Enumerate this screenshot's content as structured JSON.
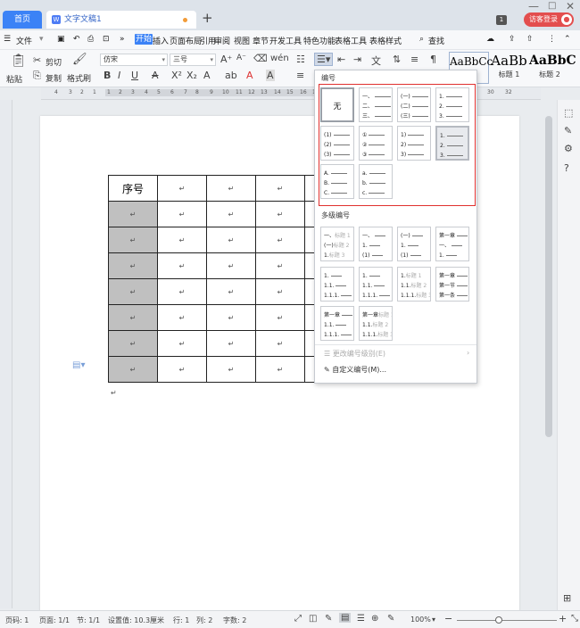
{
  "tabs": {
    "home": "首页",
    "doc": "文字文稿1"
  },
  "title_bar": {
    "page_badge": "1",
    "login_label": "访客登录"
  },
  "menu": {
    "file": "文件",
    "more": "»",
    "items": [
      "开始",
      "插入",
      "页面布局",
      "引用",
      "审阅",
      "视图",
      "章节",
      "开发工具",
      "特色功能",
      "表格工具",
      "表格样式"
    ],
    "active": "开始",
    "search": "查找"
  },
  "toolbar": {
    "paste": "粘贴",
    "cut": "剪切",
    "copy": "复制",
    "format_painter": "格式刷",
    "font_name": "仿宋",
    "font_size": "三号",
    "styles": [
      {
        "preview": "AaBbCc",
        "label": ""
      },
      {
        "preview": "AaBb",
        "label": "标题 1"
      },
      {
        "preview": "AaBbC",
        "label": "标题 2"
      }
    ]
  },
  "ruler": {
    "marks": [
      "4",
      "3",
      "2",
      "1",
      "1",
      "2",
      "3",
      "4",
      "5",
      "6",
      "7",
      "8",
      "9",
      "10",
      "11",
      "12",
      "13",
      "14",
      "15",
      "16",
      "17",
      "18",
      "19",
      "20",
      "28",
      "30",
      "32"
    ]
  },
  "table": {
    "header_first": "序号",
    "cell_mark": "↵",
    "rows": 8,
    "cols": 5
  },
  "numbering_panel": {
    "section_numbering": "编号",
    "none_label": "无",
    "single_level": [
      [
        "一、",
        "二、",
        "三、"
      ],
      [
        "(一)",
        "(二)",
        "(三)"
      ],
      [
        "1.",
        "2.",
        "3."
      ],
      [
        "(1)",
        "(2)",
        "(3)"
      ],
      [
        "①",
        "②",
        "③"
      ],
      [
        "1)",
        "2)",
        "3)"
      ],
      [
        "1.",
        "2.",
        "3."
      ],
      [
        "A.",
        "B.",
        "C."
      ],
      [
        "a.",
        "b.",
        "c."
      ]
    ],
    "section_multilevel": "多级编号",
    "multi_level": [
      [
        [
          "一、",
          "标题 1"
        ],
        [
          "(一)",
          "标题 2"
        ],
        [
          "1.",
          "标题 3"
        ]
      ],
      [
        [
          "一、",
          ""
        ],
        [
          "1.",
          ""
        ],
        [
          "(1)",
          ""
        ]
      ],
      [
        [
          "(一)",
          ""
        ],
        [
          "1.",
          ""
        ],
        [
          "(1)",
          ""
        ]
      ],
      [
        [
          "第一章",
          ""
        ],
        [
          "一、",
          ""
        ],
        [
          "1.",
          ""
        ]
      ],
      [
        [
          "1.",
          ""
        ],
        [
          "1.1.",
          ""
        ],
        [
          "1.1.1.",
          ""
        ]
      ],
      [
        [
          "1.",
          ""
        ],
        [
          "1.1.",
          ""
        ],
        [
          "1.1.1.",
          ""
        ]
      ],
      [
        [
          "1.",
          "标题 1"
        ],
        [
          "1.1.",
          "标题 2"
        ],
        [
          "1.1.1.",
          "标题 3"
        ]
      ],
      [
        [
          "第一章",
          ""
        ],
        [
          "第一节",
          ""
        ],
        [
          "第一条",
          ""
        ]
      ],
      [
        [
          "第一章",
          ""
        ],
        [
          "1.1.",
          ""
        ],
        [
          "1.1.1.",
          ""
        ]
      ],
      [
        [
          "第一章",
          "标题 1"
        ],
        [
          "1.1.",
          "标题 2"
        ],
        [
          "1.1.1.",
          "标题 3"
        ]
      ]
    ],
    "change_level": "更改编号级别(E)",
    "custom": "自定义编号(M)..."
  },
  "status": {
    "page_code": "页码: 1",
    "pages": "页面: 1/1",
    "section": "节: 1/1",
    "setting": "设置值: 10.3厘米",
    "row": "行: 1",
    "col": "列: 2",
    "words": "字数: 2",
    "zoom": "100%"
  },
  "colors": {
    "accent": "#3b82f6",
    "login": "#e34e4e",
    "highlight_box": "#e0302e",
    "shaded_cell": "#c0c0c0"
  }
}
